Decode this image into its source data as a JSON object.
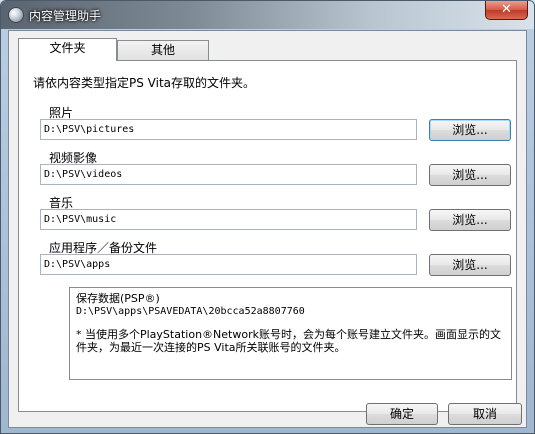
{
  "window": {
    "title": "内容管理助手",
    "close_glyph": "✕"
  },
  "tabs": [
    {
      "label": "文件夹"
    },
    {
      "label": "其他"
    }
  ],
  "intro": "请依内容类型指定PS Vita存取的文件夹。",
  "folders": [
    {
      "label": "照片",
      "path": "D:\\PSV\\pictures",
      "button": "浏览..."
    },
    {
      "label": "视频影像",
      "path": "D:\\PSV\\videos",
      "button": "浏览..."
    },
    {
      "label": "音乐",
      "path": "D:\\PSV\\music",
      "button": "浏览..."
    },
    {
      "label": "应用程序／备份文件",
      "path": "D:\\PSV\\apps",
      "button": "浏览..."
    }
  ],
  "info": {
    "heading": "保存数据(PSP®)",
    "path": "D:\\PSV\\apps\\PSAVEDATA\\20bcca52a8807760",
    "note": "* 当使用多个PlayStation®Network账号时，会为每个账号建立文件夹。画面显示的文件夹，为最近一次连接的PS Vita所关联账号的文件夹。"
  },
  "buttons": {
    "ok": "确定",
    "cancel": "取消"
  }
}
